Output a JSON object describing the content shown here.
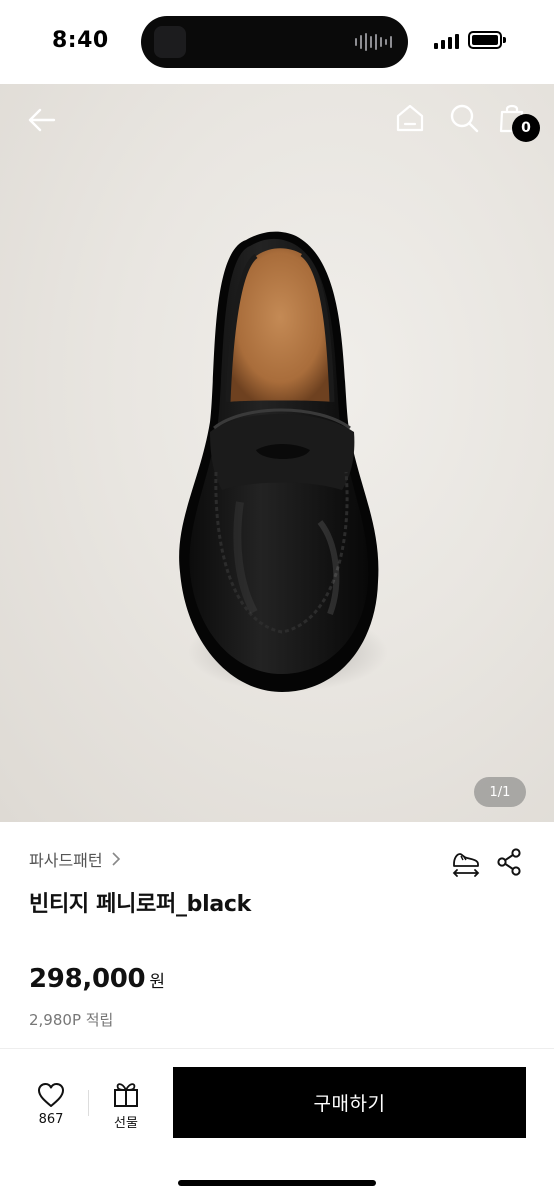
{
  "status_bar": {
    "time": "8:40",
    "icons": [
      "signal-icon",
      "battery-icon"
    ]
  },
  "header": {
    "icons": [
      "back-arrow-icon",
      "home-icon",
      "search-icon",
      "shopping-bag-icon"
    ],
    "cart_count": "0"
  },
  "gallery": {
    "page_indicator": "1/1",
    "current_page": 1,
    "total_pages": 1
  },
  "product": {
    "brand": "파사드패턴",
    "name": "빈티지 페니로퍼_black",
    "price": "298,000",
    "price_unit": "원",
    "points": "2,980P 적립",
    "action_icons": [
      "size-compare-icon",
      "share-icon"
    ]
  },
  "bottom_bar": {
    "like_count": "867",
    "gift_label": "선물",
    "buy_label": "구매하기",
    "icons": [
      "heart-icon",
      "gift-icon"
    ]
  },
  "colors": {
    "accent": "#000000",
    "background": "#ffffff",
    "image_bg": "#e9e6e1",
    "muted_text": "#777777"
  }
}
